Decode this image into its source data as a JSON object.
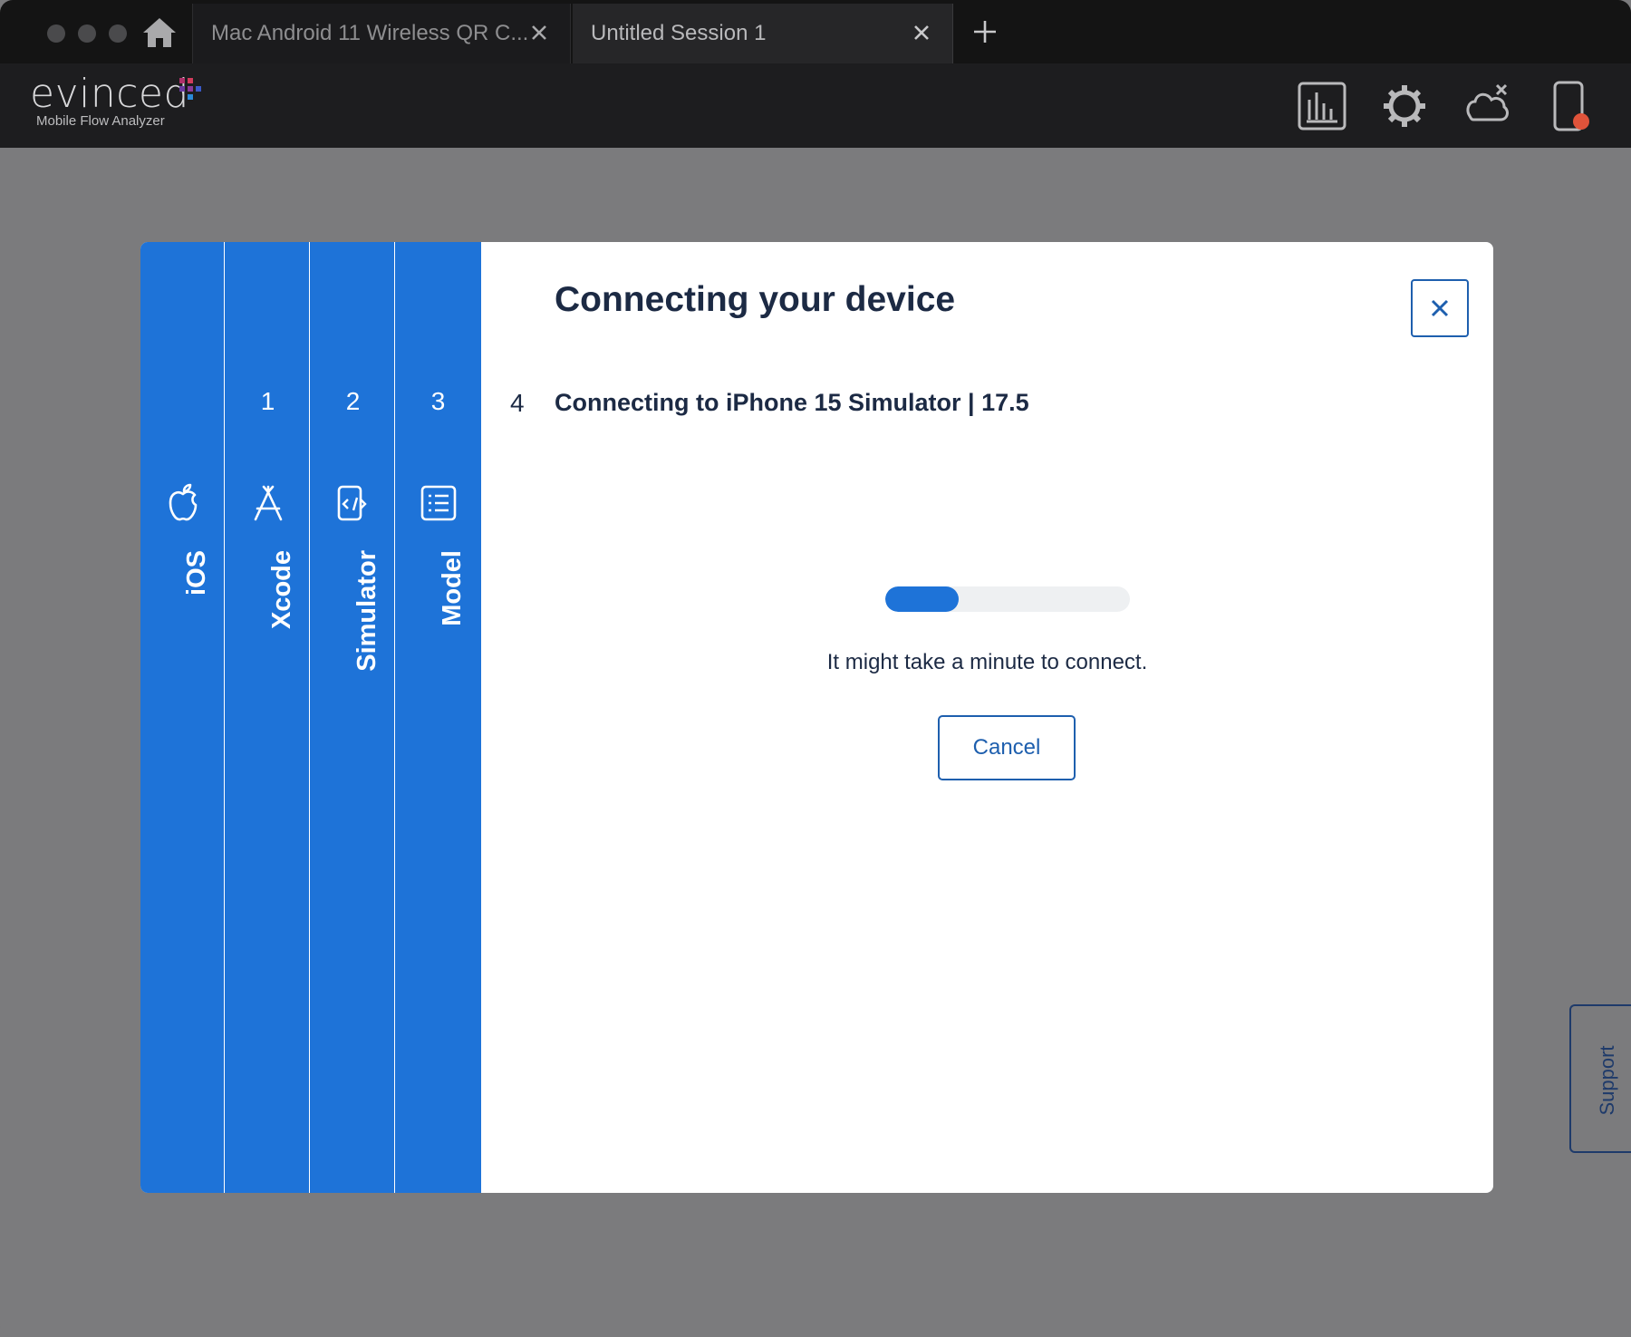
{
  "tabs": [
    {
      "label": "Mac Android 11 Wireless QR C..."
    },
    {
      "label": "Untitled Session 1"
    }
  ],
  "logo": {
    "name": "evinced",
    "subtitle": "Mobile Flow Analyzer"
  },
  "header_icons": [
    "reports-icon",
    "settings-icon",
    "cloud-disconnected-icon",
    "device-icon"
  ],
  "steps": [
    {
      "number": "",
      "label": "iOS",
      "icon": "apple-icon"
    },
    {
      "number": "1",
      "label": "Xcode",
      "icon": "app-store-icon"
    },
    {
      "number": "2",
      "label": "Simulator",
      "icon": "device-code-icon"
    },
    {
      "number": "3",
      "label": "Model",
      "icon": "list-icon"
    }
  ],
  "dialog": {
    "title": "Connecting your device",
    "current_step_number": "4",
    "current_step_text": "Connecting to iPhone 15 Simulator | 17.5",
    "progress_fraction": 0.3,
    "hint": "It might take a minute to connect.",
    "cancel_label": "Cancel"
  },
  "support_label": "Support",
  "colors": {
    "accent": "#1e73d8",
    "title": "#1c2a44",
    "button_border": "#1e5fae"
  }
}
